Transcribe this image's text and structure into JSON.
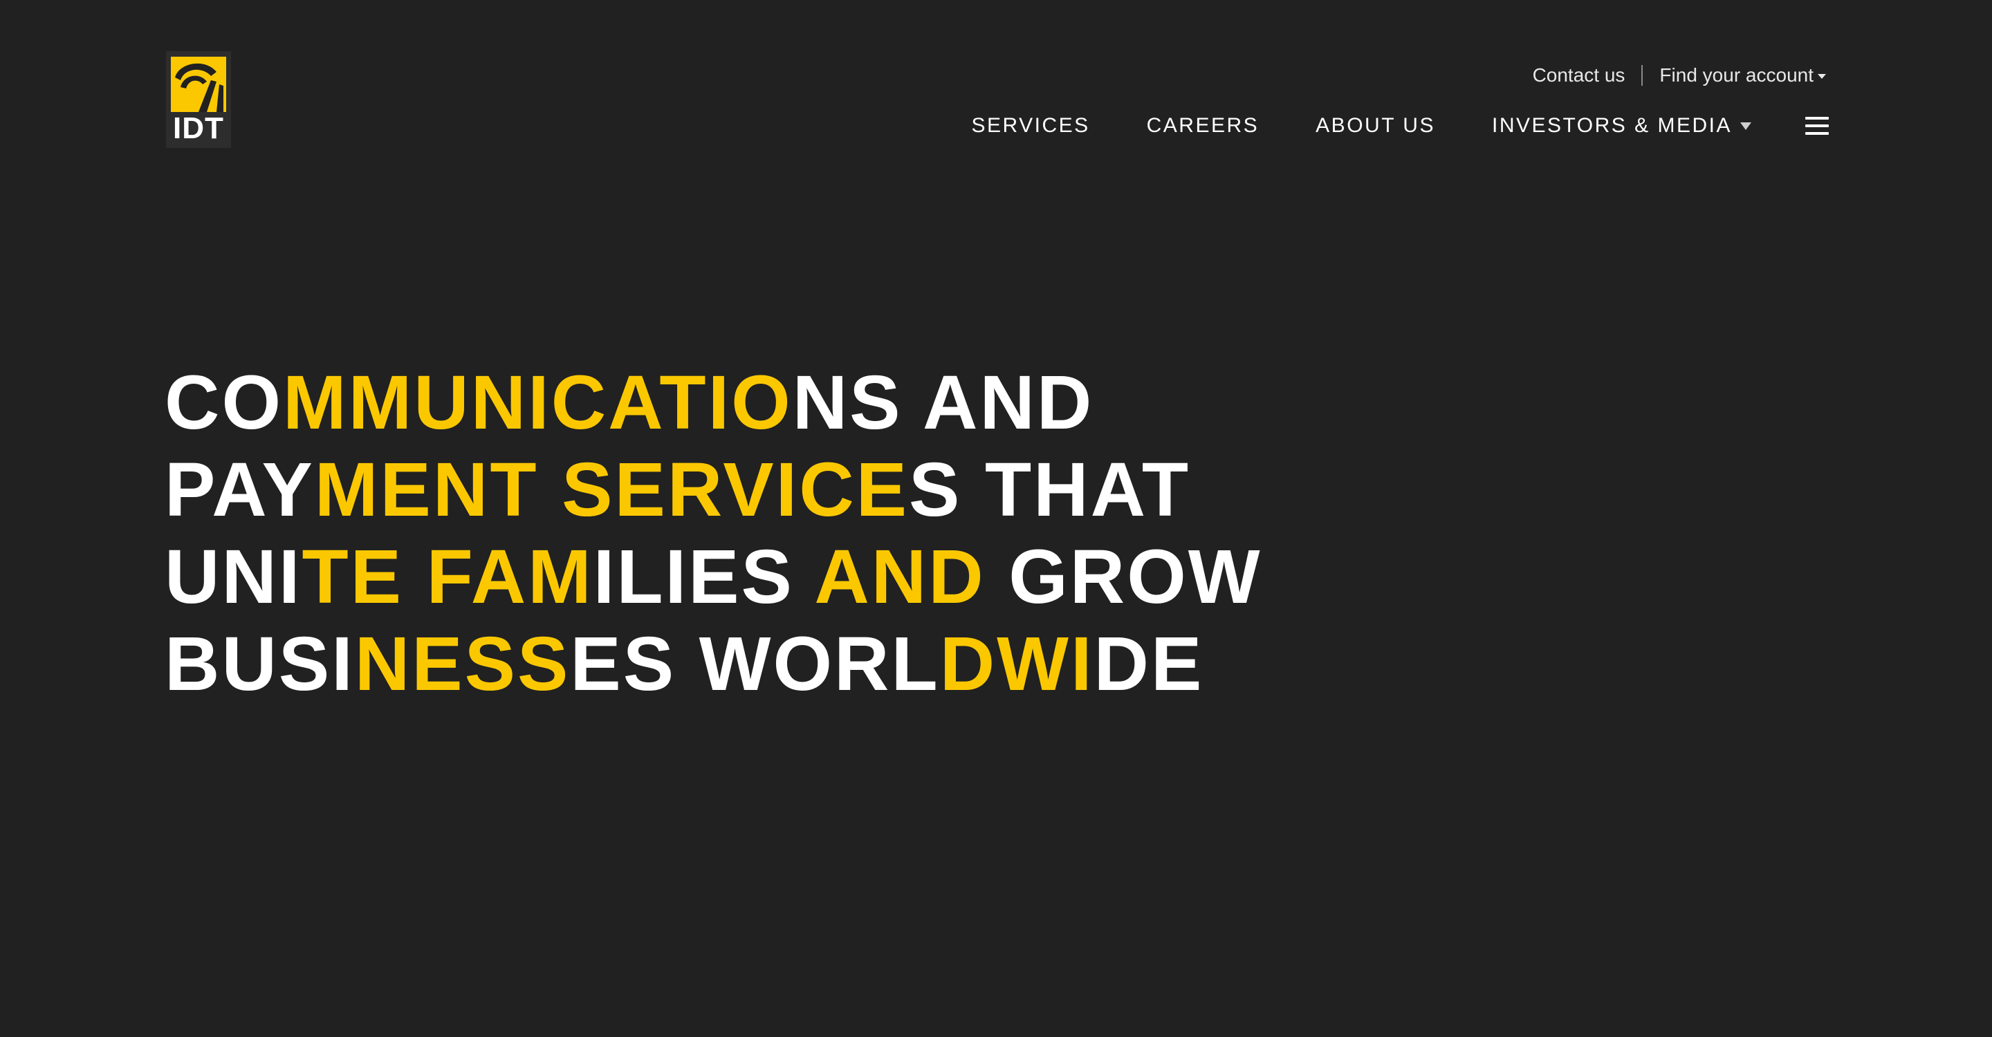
{
  "colors": {
    "background": "#212121",
    "accent": "#fbc800",
    "text": "#ffffff"
  },
  "logo": {
    "text": "IDT",
    "icon": "idt-arc-logo-icon"
  },
  "utility_nav": {
    "contact_label": "Contact us",
    "account_label": "Find your account",
    "account_icon": "caret-down-icon"
  },
  "main_nav": {
    "items": [
      {
        "label": "SERVICES"
      },
      {
        "label": "CAREERS"
      },
      {
        "label": "ABOUT US"
      },
      {
        "label": "INVESTORS & MEDIA",
        "icon": "caret-down-icon"
      }
    ],
    "menu_icon": "hamburger-menu-icon"
  },
  "hero": {
    "headline": "COMMUNICATIONS AND PAYMENT SERVICES THAT UNITE FAMILIES AND GROW BUSINESSES WORLDWIDE",
    "lines": [
      {
        "segments": [
          {
            "text": "CO",
            "highlight": false
          },
          {
            "text": "MMUNICATIO",
            "highlight": true
          },
          {
            "text": "NS AND",
            "highlight": false
          }
        ]
      },
      {
        "segments": [
          {
            "text": "PAY",
            "highlight": false
          },
          {
            "text": "MENT SERVICE",
            "highlight": true
          },
          {
            "text": "S THAT",
            "highlight": false
          }
        ]
      },
      {
        "segments": [
          {
            "text": "UNI",
            "highlight": false
          },
          {
            "text": "TE FAM",
            "highlight": true
          },
          {
            "text": "ILIES ",
            "highlight": false
          },
          {
            "text": "AND",
            "highlight": true
          },
          {
            "text": " GROW",
            "highlight": false
          }
        ]
      },
      {
        "segments": [
          {
            "text": "BUSI",
            "highlight": false
          },
          {
            "text": "NESS",
            "highlight": true
          },
          {
            "text": "ES WORL",
            "highlight": false
          },
          {
            "text": "DWI",
            "highlight": true
          },
          {
            "text": "DE",
            "highlight": false
          }
        ]
      }
    ]
  }
}
